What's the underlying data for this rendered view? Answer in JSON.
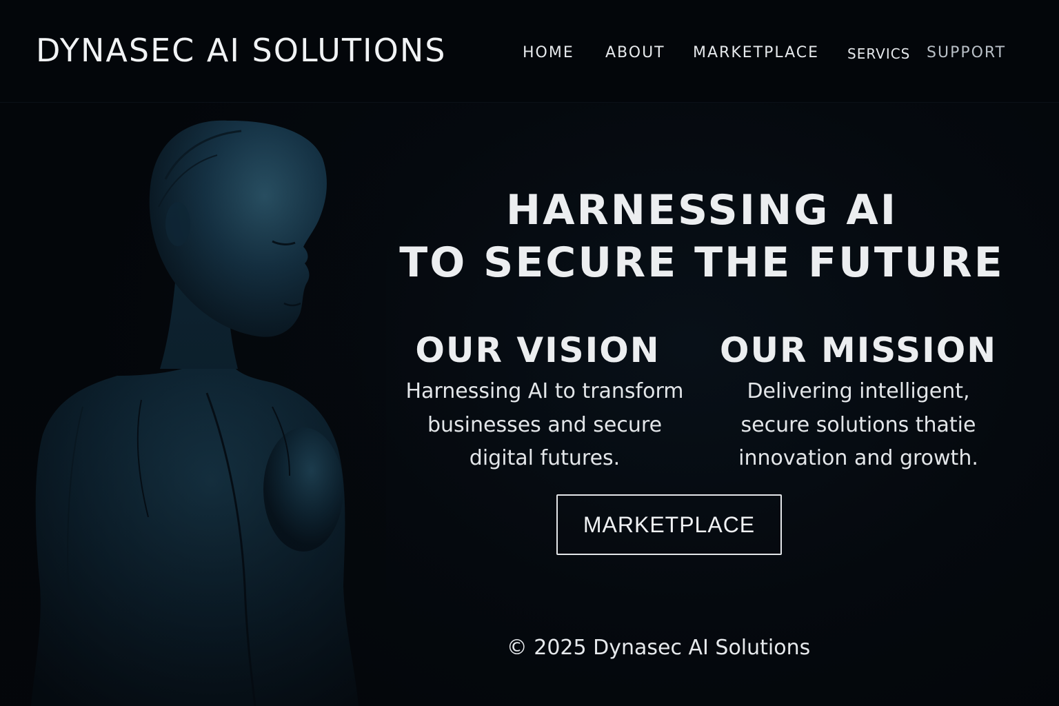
{
  "header": {
    "brand": "DYNASEC AI SOLUTIONS",
    "nav": {
      "home": "HOME",
      "about": "ABOUT",
      "marketplace": "MARKETPLACE",
      "services": "SERVICS",
      "support": "SUPPORT"
    }
  },
  "hero": {
    "title_line1": "HARNESSING AI",
    "title_line2": "TO SECURE THE FUTURE"
  },
  "vision": {
    "title": "OUR VISION",
    "lines": [
      "Harnessing AI to transform",
      "businesses and secure",
      "digital futures."
    ]
  },
  "mission": {
    "title": "OUR MISSION",
    "lines": [
      "Delivering intelligent,",
      "secure solutions thatie",
      "innovation and growth."
    ]
  },
  "cta": {
    "label": "MARKETPLACE"
  },
  "footer": {
    "copyright": "© 2025 Dynasec AI Solutions"
  },
  "colors": {
    "background": "#04070b",
    "figure": "#0d2a3a",
    "text": "#eceef0"
  }
}
